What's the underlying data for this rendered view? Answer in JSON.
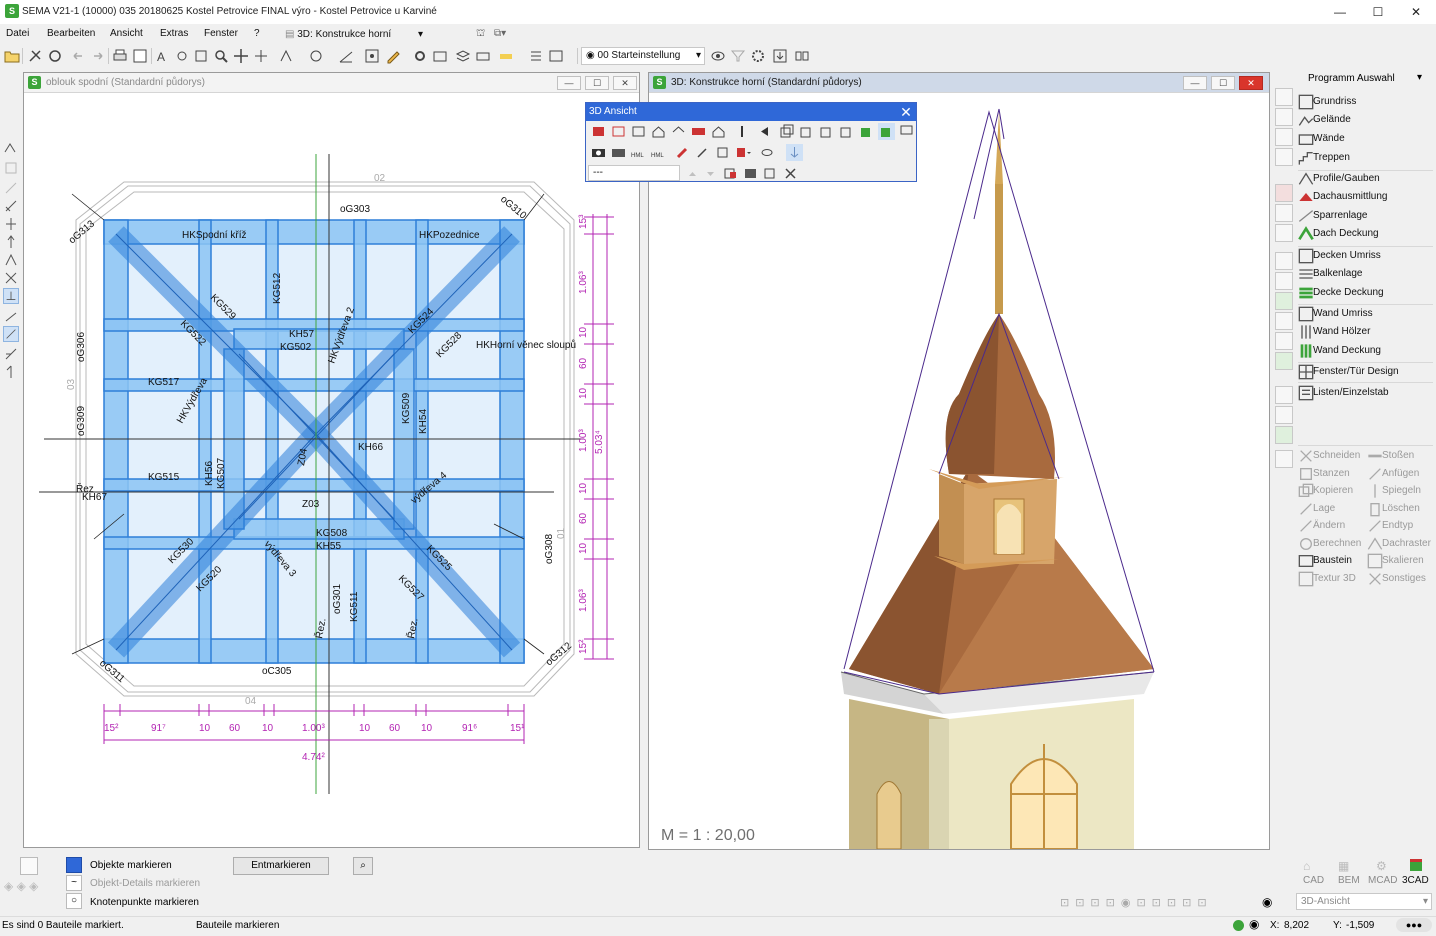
{
  "window": {
    "title": "SEMA V21-1 (10000) 035 20180625 Kostel Petrovice FINAL výro - Kostel Petrovice u Karviné",
    "app_icon_letter": "S",
    "minimize": "—",
    "maximize": "☐",
    "close": "✕"
  },
  "menu": [
    "Datei",
    "Bearbeiten",
    "Ansicht",
    "Extras",
    "Fenster",
    "?"
  ],
  "menu_view_selector": "3D: Konstrukce horní",
  "toolbar": {
    "view_setting": "00 Starteinstellung"
  },
  "left_window": {
    "title": "oblouk spodní (Standardní půdorys)",
    "labels": {
      "oG303": "oG303",
      "oG310": "oG310",
      "oG313": "oG313",
      "oG306": "oG306",
      "oG309": "oG309",
      "oG308": "oG308",
      "oG312": "oG312",
      "oG311": "oG311",
      "oG301": "oG301",
      "oC305": "oC305",
      "hk_spodni": "HKSpodní kříž",
      "hk_pozednice": "HKPozednice",
      "hk_horni": "HKHorní věnec sloupů",
      "hk_vydreva": "HKVýdřeva 2",
      "hk_vydreva2": "HKVýdřeva",
      "vydreva4": "výdřeva 4",
      "vydreva3": "výdřeva 3",
      "kg512": "KG512",
      "kg529": "KG529",
      "kg522": "KG522",
      "kg524": "KG524",
      "kg528": "KG528",
      "kg517": "KG517",
      "kg515": "KG515",
      "kg530": "KG530",
      "kg520": "KG520",
      "kg525": "KG525",
      "kg527": "KG527",
      "kg508": "KG508",
      "kg511": "KG511",
      "kg507": "KG507",
      "kg509": "KG509",
      "kg502": "KG502",
      "kh57": "KH57",
      "kh66": "KH66",
      "kh55": "KH55",
      "kh56": "KH56",
      "kh54": "KH54",
      "kh67": "KH67",
      "z03": "Z03",
      "z04": "Z04",
      "rez": "Řez",
      "rez2": "Řez.",
      "n02": "02",
      "n03": "03",
      "n01": "01",
      "n04": "04"
    },
    "dims_bottom": [
      "15²",
      "91⁷",
      "10",
      "60",
      "10",
      "1.00³",
      "10",
      "60",
      "10",
      "91⁶",
      "15¹"
    ],
    "dim_total_bottom": "4.74²",
    "dims_right": [
      "15³",
      "1.06³",
      "10",
      "60",
      "10",
      "1.00³",
      "10",
      "60",
      "10",
      "1.06³",
      "15²"
    ],
    "dim_total_right": "5.03⁴"
  },
  "right_window": {
    "title": "3D: Konstrukce horní (Standardní půdorys)",
    "scale": "M = 1 : 20,00"
  },
  "float_3d": {
    "title": "3D Ansicht",
    "input_value": "---"
  },
  "right_panel": {
    "header": "Programm Auswahl",
    "groups": [
      [
        "Grundriss",
        "Gelände",
        "Wände",
        "Treppen"
      ],
      [
        "Profile/Gauben",
        "Dachausmittlung",
        "Sparrenlage",
        "Dach Deckung"
      ],
      [
        "Decken Umriss",
        "Balkenlage",
        "Decke Deckung"
      ],
      [
        "Wand Umriss",
        "Wand Hölzer",
        "Wand Deckung"
      ],
      [
        "Fenster/Tür Design"
      ],
      [
        "Listen/Einzelstab"
      ]
    ],
    "tools_left": [
      "Schneiden",
      "Stanzen",
      "Kopieren",
      "Lage",
      "Ändern",
      "Berechnen",
      "Baustein",
      "Textur 3D"
    ],
    "tools_right": [
      "Stoßen",
      "Anfügen",
      "Spiegeln",
      "Löschen",
      "Endtyp",
      "Dachraster",
      "Skalieren",
      "Sonstiges"
    ],
    "modes": [
      "CAD",
      "BEM",
      "MCAD",
      "3CAD"
    ],
    "view_dropdown": "3D-Ansicht"
  },
  "bottom": {
    "opt1": "Objekte markieren",
    "opt2": "Objekt-Details markieren",
    "opt3": "Knotenpunkte markieren",
    "entmarkieren": "Entmarkieren"
  },
  "status": {
    "left": "Es sind 0 Bauteile markiert.",
    "mid": "Bauteile markieren",
    "x_label": "X:",
    "x_value": "8,202",
    "y_label": "Y:",
    "y_value": "-1,509"
  },
  "colors": {
    "accent_blue": "#2f68d8",
    "beam_blue": "#3d8fe0",
    "dim_magenta": "#b324b3",
    "roof_brown": "#a86a3e",
    "wall_cream": "#ece7c4",
    "spire_gold": "#c69a4c",
    "green": "#3ca43a",
    "close_red": "#d9352b"
  }
}
